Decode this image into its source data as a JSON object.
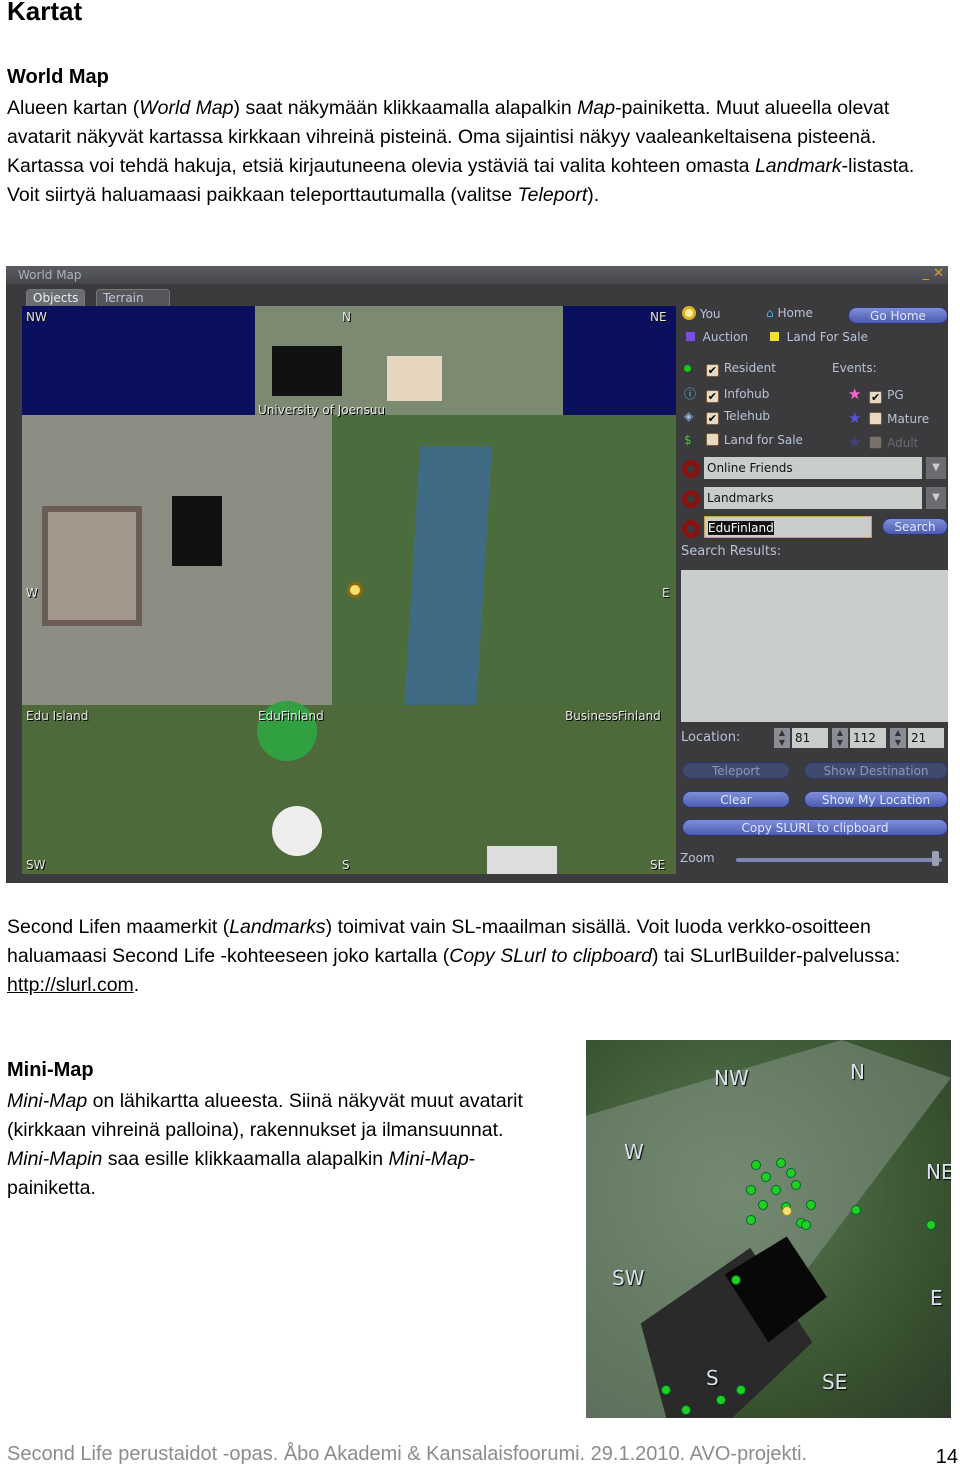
{
  "heading": "Kartat",
  "world_map": {
    "heading": "World Map",
    "para1": [
      {
        "t": "Alueen kartan ("
      },
      {
        "i": "World Map"
      },
      {
        "t": ") saat näkymään klikkaamalla alapalkin "
      },
      {
        "i": "Map"
      },
      {
        "t": "-painiketta. Muut alueella olevat avatarit näkyvät kartassa kirkkaan vihreinä pisteinä. Oma sijaintisi näkyy vaaleankeltaisena pisteenä. Kartassa voi tehdä hakuja, etsiä kirjautuneena olevia ystäviä tai valita kohteen omasta "
      },
      {
        "i": "Landmark"
      },
      {
        "t": "-listasta. Voit siirtyä haluamaasi paikkaan teleporttautumalla (valitse "
      },
      {
        "i": "Teleport"
      },
      {
        "t": ")."
      }
    ],
    "para2": [
      {
        "t": "Second Lifen maamerkit ("
      },
      {
        "i": "Landmarks"
      },
      {
        "t": ") toimivat vain SL-maailman sisällä. Voit luoda verkko-osoitteen haluamaasi Second Life -kohteeseen joko kartalla ("
      },
      {
        "i": "Copy SLurl to clipboard"
      },
      {
        "t": ") tai SLurlBuilder-palvelussa: "
      },
      {
        "a": "http://slurl.com"
      },
      {
        "t": "."
      }
    ]
  },
  "window": {
    "title": "World Map",
    "tabs": [
      "Objects",
      "Terrain"
    ],
    "map_labels": {
      "nw": "NW",
      "n": "N",
      "ne": "NE",
      "w": "W",
      "e": "E",
      "sw": "SW",
      "s": "S",
      "se": "SE",
      "region1": "University of Joensuu",
      "region2": "Edu Island",
      "region3": "EduFinland",
      "region4": "BusinessFinland"
    },
    "legend": {
      "you": "You",
      "home": "Home",
      "go_home": "Go Home",
      "auction": "Auction",
      "land_for_sale": "Land For Sale"
    },
    "filters": [
      {
        "label": "Resident",
        "checked": true
      },
      {
        "label": "Infohub",
        "checked": true
      },
      {
        "label": "Telehub",
        "checked": true
      },
      {
        "label": "Land for Sale",
        "checked": false
      }
    ],
    "events": {
      "label": "Events:",
      "items": [
        {
          "label": "PG",
          "checked": true
        },
        {
          "label": "Mature",
          "checked": false
        },
        {
          "label": "Adult",
          "checked": false,
          "disabled": true
        }
      ]
    },
    "friends_select": "Online Friends",
    "landmarks_select": "Landmarks",
    "search_value": "EduFinland",
    "search_button": "Search",
    "search_results_label": "Search Results:",
    "location_label": "Location:",
    "location": [
      "81",
      "112",
      "21"
    ],
    "buttons": {
      "teleport": "Teleport",
      "show_destination": "Show Destination",
      "clear": "Clear",
      "show_my_location": "Show My Location",
      "copy_slurl": "Copy SLURL to clipboard"
    },
    "zoom_label": "Zoom",
    "zoom_level": 0.98
  },
  "mini_map": {
    "heading": "Mini-Map",
    "para": [
      {
        "i": "Mini-Map"
      },
      {
        "t": " on lähikartta alueesta. Siinä näkyvät muut avatarit (kirkkaan vihreinä palloina), rakennukset ja ilmansuunnat. "
      },
      {
        "i": "Mini-Mapin"
      },
      {
        "t": " saa esille klikkaamalla alapalkin "
      },
      {
        "i": "Mini-Map"
      },
      {
        "t": "-painiketta."
      }
    ],
    "labels": {
      "nw": "NW",
      "n": "N",
      "ne": "NE",
      "w": "W",
      "e": "E",
      "sw": "SW",
      "s": "S",
      "se": "SE"
    }
  },
  "footer": "Second Life perustaidot -opas. Åbo Akademi & Kansalaisfoorumi. 29.1.2010. AVO-projekti.",
  "page_number": "14"
}
